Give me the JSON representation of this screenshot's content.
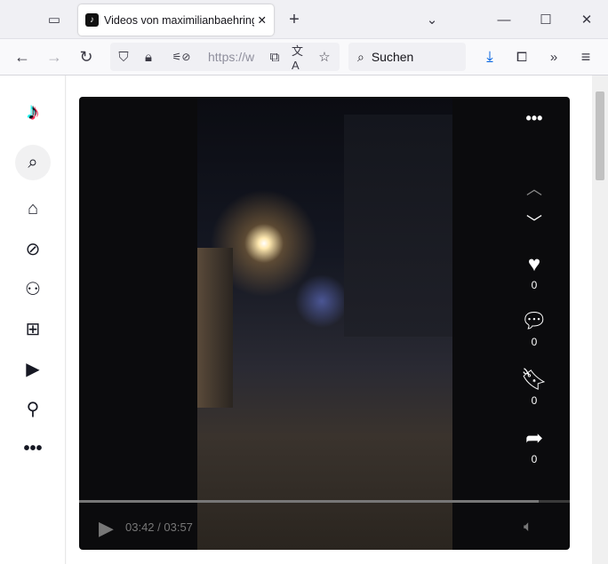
{
  "browser": {
    "tab_title": "Videos von maximilianbaehring",
    "url": "https://w",
    "search_placeholder": "Suchen"
  },
  "sidebar": {
    "items": [
      "search",
      "home",
      "explore",
      "following",
      "upload",
      "live",
      "profile",
      "more"
    ]
  },
  "video": {
    "time": "03:42 / 03:57",
    "progress": 0.937,
    "actions": [
      {
        "icon": "heart-icon",
        "count": "0"
      },
      {
        "icon": "comment-icon",
        "count": "0"
      },
      {
        "icon": "bookmark-icon",
        "count": "0"
      },
      {
        "icon": "share-icon",
        "count": "0"
      }
    ]
  }
}
